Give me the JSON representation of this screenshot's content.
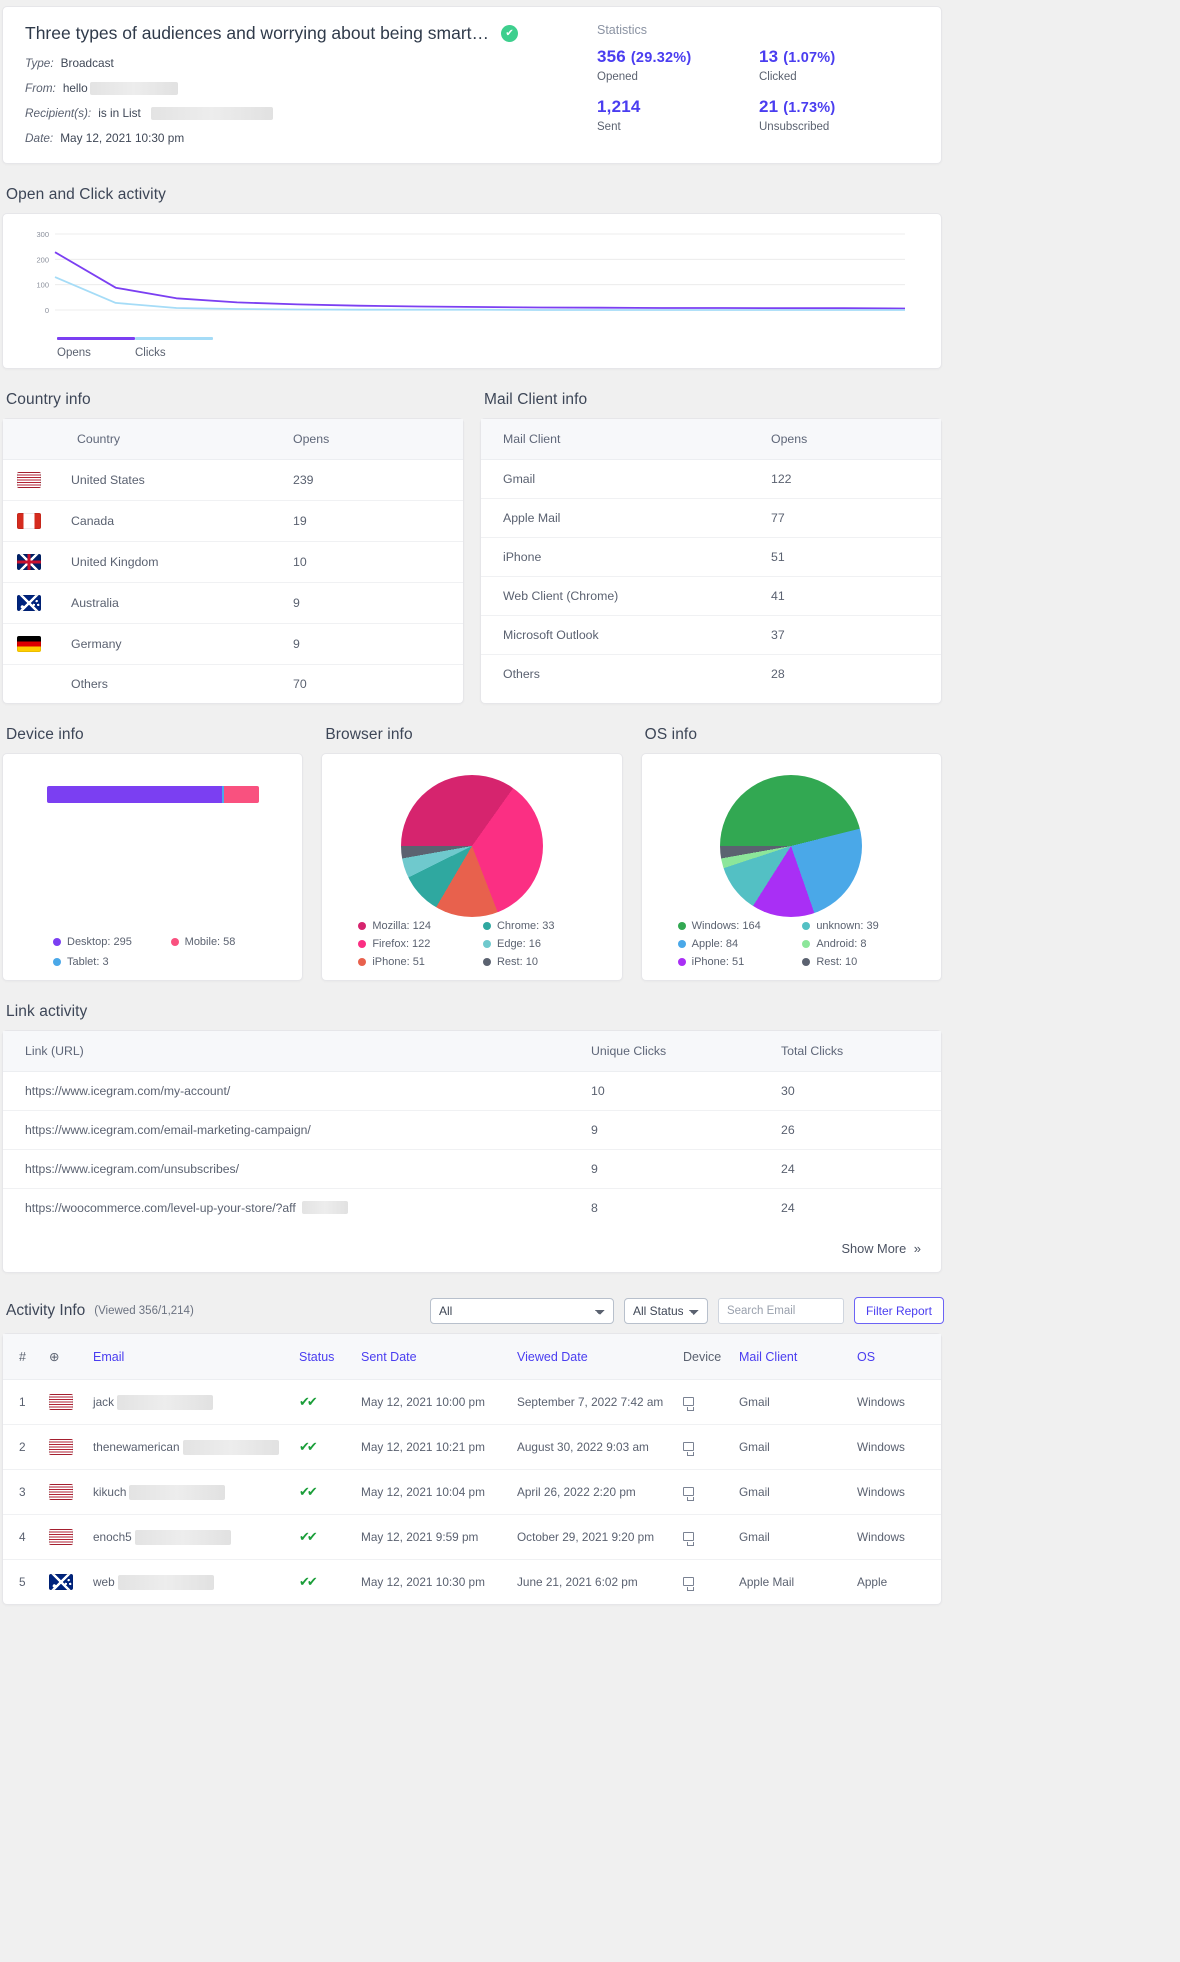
{
  "header": {
    "title": "Three types of audiences and worrying about being smart…",
    "verified_icon": "check-circle-icon",
    "type_label": "Type:",
    "type_value": "Broadcast",
    "from_label": "From:",
    "from_value": "hello",
    "recipients_label": "Recipient(s):",
    "recipients_value": "is in List",
    "date_label": "Date:",
    "date_value": "May 12, 2021 10:30 pm"
  },
  "statistics": {
    "label": "Statistics",
    "items": [
      {
        "value": "356",
        "pct": "(29.32%)",
        "caption": "Opened"
      },
      {
        "value": "13",
        "pct": "(1.07%)",
        "caption": "Clicked"
      },
      {
        "value": "1,214",
        "pct": "",
        "caption": "Sent"
      },
      {
        "value": "21",
        "pct": "(1.73%)",
        "caption": "Unsubscribed"
      }
    ]
  },
  "open_click": {
    "title": "Open and Click activity",
    "legend": [
      {
        "label": "Opens",
        "color": "#7b3ff2"
      },
      {
        "label": "Clicks",
        "color": "#a5dcf7"
      }
    ]
  },
  "chart_data": [
    {
      "type": "line",
      "title": "Open and Click activity",
      "xlabel": "",
      "ylabel": "",
      "ylim": [
        0,
        300
      ],
      "yticks": [
        0,
        100,
        200,
        300
      ],
      "grid": true,
      "legend_position": "bottom-left",
      "x": [
        0,
        1,
        2,
        3,
        4,
        5,
        6,
        7,
        8,
        9,
        10,
        11,
        12,
        13,
        14
      ],
      "series": [
        {
          "name": "Opens",
          "color": "#7b3ff2",
          "values": [
            228,
            88,
            46,
            30,
            22,
            17,
            14,
            12,
            10,
            9,
            8,
            8,
            7,
            7,
            6
          ]
        },
        {
          "name": "Clicks",
          "color": "#a5dcf7",
          "values": [
            130,
            28,
            8,
            4,
            2,
            1,
            1,
            1,
            0,
            0,
            0,
            0,
            0,
            0,
            0
          ]
        }
      ]
    },
    {
      "type": "bar",
      "title": "Device info",
      "orientation": "horizontal-stacked",
      "categories": [
        "Desktop",
        "Tablet",
        "Mobile"
      ],
      "values": [
        295,
        3,
        58
      ],
      "colors": [
        "#7b3ff2",
        "#4aa8e8",
        "#f9517f"
      ]
    },
    {
      "type": "pie",
      "title": "Browser info",
      "categories": [
        "Mozilla",
        "Firefox",
        "iPhone",
        "Chrome",
        "Edge",
        "Rest"
      ],
      "values": [
        124,
        122,
        51,
        33,
        16,
        10
      ],
      "colors": [
        "#d6246e",
        "#fb2f83",
        "#e8614d",
        "#2fa8a0",
        "#6fc9cd",
        "#5b6270"
      ]
    },
    {
      "type": "pie",
      "title": "OS info",
      "categories": [
        "Windows",
        "Apple",
        "iPhone",
        "unknown",
        "Android",
        "Rest"
      ],
      "values": [
        164,
        84,
        51,
        39,
        8,
        10
      ],
      "colors": [
        "#32a852",
        "#4aa8e8",
        "#a92ff5",
        "#53c0c4",
        "#8ce69a",
        "#5b6270"
      ]
    }
  ],
  "country_info": {
    "title": "Country info",
    "columns": [
      "",
      "Country",
      "Opens"
    ],
    "rows": [
      {
        "flag": "flag-us-icon",
        "country": "United States",
        "opens": "239"
      },
      {
        "flag": "flag-ca-icon",
        "country": "Canada",
        "opens": "19"
      },
      {
        "flag": "flag-gb-icon",
        "country": "United Kingdom",
        "opens": "10"
      },
      {
        "flag": "flag-au-icon",
        "country": "Australia",
        "opens": "9"
      },
      {
        "flag": "flag-de-icon",
        "country": "Germany",
        "opens": "9"
      },
      {
        "flag": "",
        "country": "Others",
        "opens": "70"
      }
    ]
  },
  "mail_client_info": {
    "title": "Mail Client info",
    "columns": [
      "Mail Client",
      "Opens"
    ],
    "rows": [
      {
        "client": "Gmail",
        "opens": "122"
      },
      {
        "client": "Apple Mail",
        "opens": "77"
      },
      {
        "client": "iPhone",
        "opens": "51"
      },
      {
        "client": "Web Client (Chrome)",
        "opens": "41"
      },
      {
        "client": "Microsoft Outlook",
        "opens": "37"
      },
      {
        "client": "Others",
        "opens": "28"
      }
    ]
  },
  "device_info": {
    "title": "Device info",
    "legend": [
      {
        "label": "Desktop: 295",
        "color": "#7b3ff2"
      },
      {
        "label": "Tablet: 3",
        "color": "#4aa8e8"
      },
      {
        "label": "Mobile: 58",
        "color": "#f9517f"
      }
    ]
  },
  "browser_info": {
    "title": "Browser info",
    "legend": [
      {
        "label": "Mozilla: 124",
        "color": "#d6246e"
      },
      {
        "label": "Firefox: 122",
        "color": "#fb2f83"
      },
      {
        "label": "iPhone: 51",
        "color": "#e8614d"
      },
      {
        "label": "Chrome: 33",
        "color": "#2fa8a0"
      },
      {
        "label": "Edge: 16",
        "color": "#6fc9cd"
      },
      {
        "label": "Rest: 10",
        "color": "#5b6270"
      }
    ]
  },
  "os_info": {
    "title": "OS info",
    "legend": [
      {
        "label": "Windows: 164",
        "color": "#32a852"
      },
      {
        "label": "Apple: 84",
        "color": "#4aa8e8"
      },
      {
        "label": "iPhone: 51",
        "color": "#a92ff5"
      },
      {
        "label": "unknown: 39",
        "color": "#53c0c4"
      },
      {
        "label": "Android: 8",
        "color": "#8ce69a"
      },
      {
        "label": "Rest: 10",
        "color": "#5b6270"
      }
    ]
  },
  "link_activity": {
    "title": "Link activity",
    "columns": [
      "Link (URL)",
      "Unique Clicks",
      "Total Clicks"
    ],
    "rows": [
      {
        "url": "https://www.icegram.com/my-account/",
        "unique": "10",
        "total": "30",
        "redacted": false
      },
      {
        "url": "https://www.icegram.com/email-marketing-campaign/",
        "unique": "9",
        "total": "26",
        "redacted": false
      },
      {
        "url": "https://www.icegram.com/unsubscribes/",
        "unique": "9",
        "total": "24",
        "redacted": false
      },
      {
        "url": "https://woocommerce.com/level-up-your-store/?aff",
        "unique": "8",
        "total": "24",
        "redacted": true
      }
    ],
    "show_more": "Show More"
  },
  "activity_info": {
    "title": "Activity Info",
    "subtitle": "(Viewed 356/1,214)",
    "filter_all": "All",
    "filter_status": "All Status",
    "search_placeholder": "Search Email",
    "filter_button": "Filter Report",
    "columns": [
      "#",
      "globe-icon",
      "Email",
      "Status",
      "Sent Date",
      "Viewed Date",
      "Device",
      "Mail Client",
      "OS"
    ],
    "rows": [
      {
        "num": "1",
        "flag": "flag-us-icon",
        "email": "jack",
        "status": "double-check-icon",
        "sent": "May 12, 2021 10:00 pm",
        "viewed": "September 7, 2022 7:42 am",
        "device": "desktop-icon",
        "client": "Gmail",
        "os": "Windows"
      },
      {
        "num": "2",
        "flag": "flag-us-icon",
        "email": "thenewamerican",
        "status": "double-check-icon",
        "sent": "May 12, 2021 10:21 pm",
        "viewed": "August 30, 2022 9:03 am",
        "device": "desktop-icon",
        "client": "Gmail",
        "os": "Windows"
      },
      {
        "num": "3",
        "flag": "flag-us-icon",
        "email": "kikuch",
        "status": "double-check-icon",
        "sent": "May 12, 2021 10:04 pm",
        "viewed": "April 26, 2022 2:20 pm",
        "device": "desktop-icon",
        "client": "Gmail",
        "os": "Windows"
      },
      {
        "num": "4",
        "flag": "flag-us-icon",
        "email": "enoch5",
        "status": "double-check-icon",
        "sent": "May 12, 2021 9:59 pm",
        "viewed": "October 29, 2021 9:20 pm",
        "device": "desktop-icon",
        "client": "Gmail",
        "os": "Windows"
      },
      {
        "num": "5",
        "flag": "flag-au-icon",
        "email": "web",
        "status": "double-check-icon",
        "sent": "May 12, 2021 10:30 pm",
        "viewed": "June 21, 2021 6:02 pm",
        "device": "desktop-icon",
        "client": "Apple Mail",
        "os": "Apple"
      }
    ]
  },
  "colors": {
    "accent": "#4a3df0",
    "link": "#4a3df0",
    "verified": "#3ecf8e"
  }
}
